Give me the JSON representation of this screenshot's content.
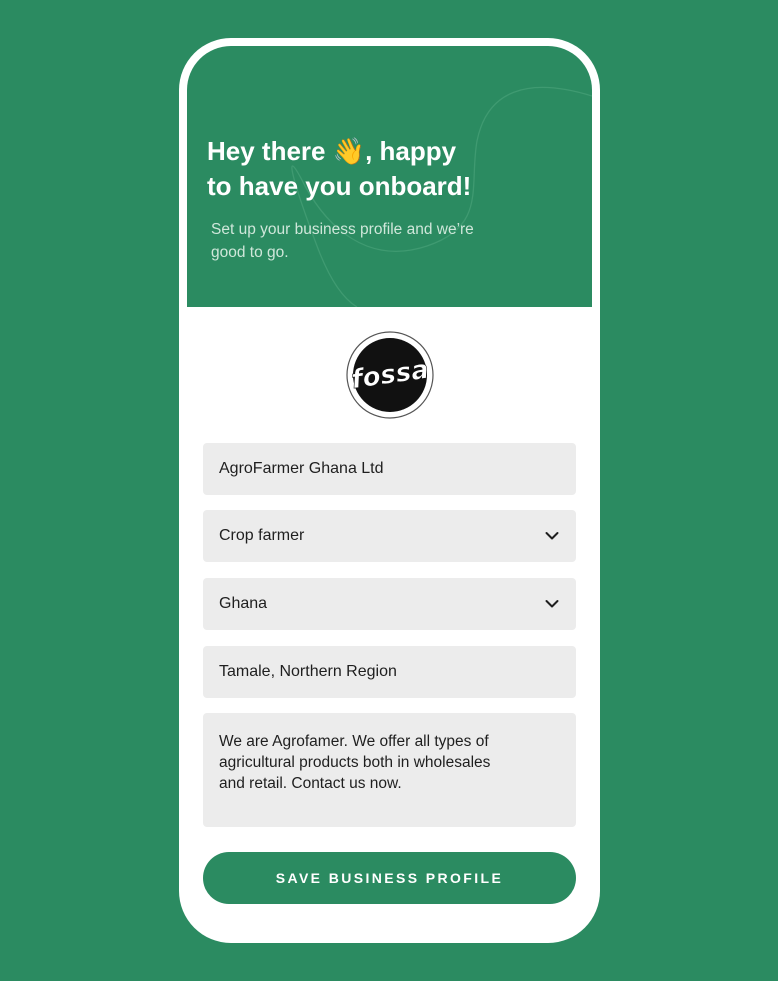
{
  "header": {
    "title_line1": "Hey there 👋, happy",
    "title_line2": "to have you onboard!",
    "subtitle": "Set up your business profile and we’re good to go."
  },
  "logo": {
    "text": "fossa"
  },
  "form": {
    "business_name": "AgroFarmer Ghana Ltd",
    "business_type": "Crop farmer",
    "country": "Ghana",
    "location": "Tamale, Northern Region",
    "description": "We are Agrofamer. We offer all types of agricultural products both in wholesales and retail. Contact us now."
  },
  "actions": {
    "save_label": "SAVE BUSINESS PROFILE"
  },
  "colors": {
    "brand_green": "#2b8b61",
    "field_bg": "#ececec"
  },
  "icons": [
    "chevron-down-icon",
    "waving-hand-emoji"
  ]
}
